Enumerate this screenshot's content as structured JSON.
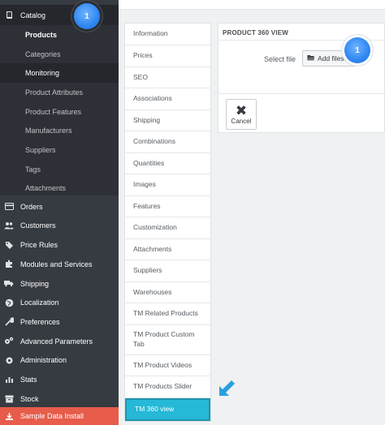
{
  "sidebar": {
    "catalog_label": "Catalog",
    "submenu": [
      {
        "label": "Products"
      },
      {
        "label": "Categories"
      },
      {
        "label": "Monitoring"
      },
      {
        "label": "Product Attributes"
      },
      {
        "label": "Product Features"
      },
      {
        "label": "Manufacturers"
      },
      {
        "label": "Suppliers"
      },
      {
        "label": "Tags"
      },
      {
        "label": "Attachments"
      }
    ],
    "items": [
      {
        "label": "Orders"
      },
      {
        "label": "Customers"
      },
      {
        "label": "Price Rules"
      },
      {
        "label": "Modules and Services"
      },
      {
        "label": "Shipping"
      },
      {
        "label": "Localization"
      },
      {
        "label": "Preferences"
      },
      {
        "label": "Advanced Parameters"
      },
      {
        "label": "Administration"
      },
      {
        "label": "Stats"
      },
      {
        "label": "Stock"
      }
    ],
    "sample_data_label": "Sample Data Install"
  },
  "badges": {
    "step1_sidebar": "1",
    "step1_panel": "1"
  },
  "tabs": [
    {
      "label": "Information"
    },
    {
      "label": "Prices"
    },
    {
      "label": "SEO"
    },
    {
      "label": "Associations"
    },
    {
      "label": "Shipping"
    },
    {
      "label": "Combinations"
    },
    {
      "label": "Quantities"
    },
    {
      "label": "Images"
    },
    {
      "label": "Features"
    },
    {
      "label": "Customization"
    },
    {
      "label": "Attachments"
    },
    {
      "label": "Suppliers"
    },
    {
      "label": "Warehouses"
    },
    {
      "label": "TM Related Products"
    },
    {
      "label": "TM Product Custom Tab"
    },
    {
      "label": "TM Product Videos"
    },
    {
      "label": "TM Products Slider"
    },
    {
      "label": "TM 360 view"
    }
  ],
  "panel": {
    "title": "PRODUCT 360 VIEW",
    "select_file_label": "Select file",
    "add_files_label": "Add files...",
    "cancel_label": "Cancel"
  },
  "colors": {
    "sidebar_bg": "#363a41",
    "active_tab": "#25b9d7",
    "sample_data": "#e75c4b",
    "badge": "#2f86f2",
    "arrow": "#2a9fe0"
  }
}
